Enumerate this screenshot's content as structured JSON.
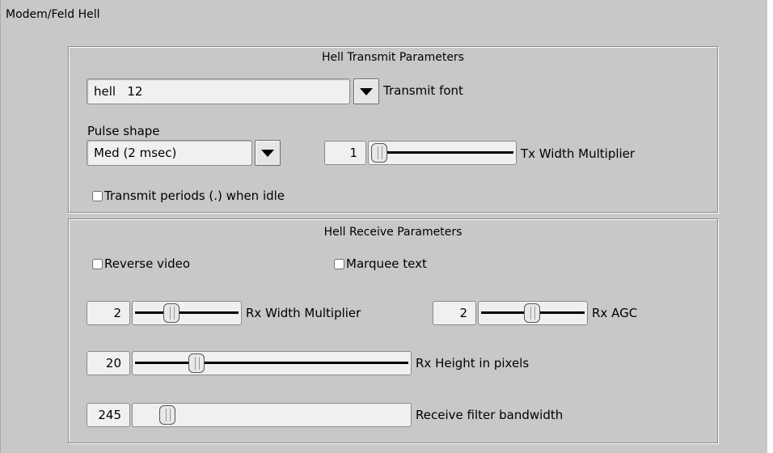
{
  "tab_title": "Modem/Feld Hell",
  "transmit": {
    "group_label": "Hell Transmit Parameters",
    "font_value": "hell   12",
    "font_label": "Transmit font",
    "pulse_label": "Pulse shape",
    "pulse_value": "Med (2 msec)",
    "tx_width_value": "1",
    "tx_width_label": "Tx Width Multiplier",
    "periods_label": "Transmit periods (.) when idle",
    "periods_checked": false
  },
  "receive": {
    "group_label": "Hell Receive Parameters",
    "reverse_label": "Reverse video",
    "reverse_checked": false,
    "marquee_label": "Marquee text",
    "marquee_checked": false,
    "rx_width_value": "2",
    "rx_width_label": "Rx Width Multiplier",
    "rx_agc_value": "2",
    "rx_agc_label": "Rx AGC",
    "rx_height_value": "20",
    "rx_height_label": "Rx Height in pixels",
    "bandwidth_value": "245",
    "bandwidth_label": "Receive filter bandwidth"
  },
  "icons": {
    "dropdown": "chevron-down-icon"
  }
}
